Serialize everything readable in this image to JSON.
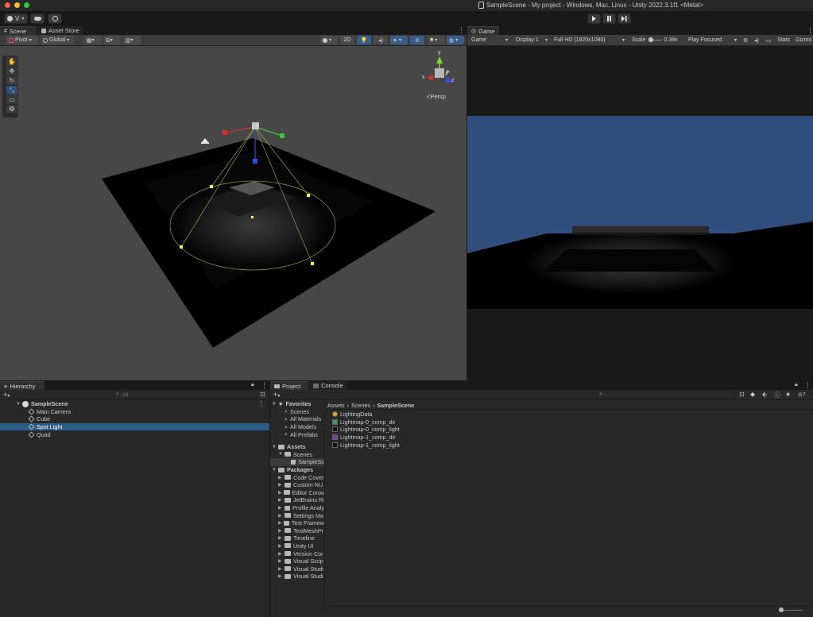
{
  "window": {
    "title": "SampleScene - My project - Windows, Mac, Linux - Unity 2022.3.1f1 <Metal>"
  },
  "toolbar": {
    "account_label": "V",
    "play_icon": "play-icon",
    "pause_icon": "pause-icon",
    "step_icon": "step-icon"
  },
  "scene_view": {
    "tabs": [
      {
        "label": "Scene"
      },
      {
        "label": "Asset Store"
      }
    ],
    "pivot_label": "Pivot",
    "global_label": "Global",
    "mode_2d_label": "2D",
    "persp_label": "Persp",
    "gizmo_axis_labels": {
      "y": "y",
      "x": "x",
      "z": "z"
    }
  },
  "game_view": {
    "tab_label": "Game",
    "game_dropdown": "Game",
    "display_dropdown": "Display 1",
    "resolution_dropdown": "Full HD (1920x1080)",
    "scale_label": "Scale",
    "scale_value": "0.38x",
    "play_focused": "Play Focused",
    "stats_label": "Stats",
    "gizmos_label": "Gizmo",
    "sky_color": "#2f4d7d"
  },
  "hierarchy": {
    "tab_label": "Hierarchy",
    "search_placeholder": "All",
    "scene_name": "SampleScene",
    "items": [
      {
        "label": "Main Camera",
        "selected": false
      },
      {
        "label": "Cube",
        "selected": false
      },
      {
        "label": "Spot Light",
        "selected": true
      },
      {
        "label": "Quad",
        "selected": false
      }
    ]
  },
  "project": {
    "tabs": [
      {
        "label": "Project"
      },
      {
        "label": "Console"
      }
    ],
    "hidden_count": "7",
    "favorites_label": "Favorites",
    "favorites": [
      "Scenes",
      "All Materials",
      "All Models",
      "All Prefabs"
    ],
    "assets_label": "Assets",
    "scenes_folder": "Scenes",
    "scenes_child": "SampleSc",
    "packages_label": "Packages",
    "packages": [
      "Code Cover",
      "Custom NU",
      "Editor Corou",
      "JetBrains Ri",
      "Profile Analy",
      "Settings Ma",
      "Test Framew",
      "TextMeshPr",
      "Timeline",
      "Unity UI",
      "Version Cor",
      "Visual Scrip",
      "Visual Studi",
      "Visual Studi"
    ],
    "breadcrumb": [
      "Assets",
      "Scenes",
      "SampleScene"
    ],
    "files": [
      {
        "label": "LightingData",
        "icon": "lighting-data-icon",
        "color": "#e0b020"
      },
      {
        "label": "Lightmap-0_comp_dir",
        "icon": "texture-icon",
        "color": "#3a9a5a"
      },
      {
        "label": "Lightmap-0_comp_light",
        "icon": "texture-icon",
        "color": "#151515"
      },
      {
        "label": "Lightmap-1_comp_dir",
        "icon": "texture-icon",
        "color": "#7a3aa8"
      },
      {
        "label": "Lightmap-1_comp_light",
        "icon": "texture-icon",
        "color": "#151515"
      }
    ]
  }
}
